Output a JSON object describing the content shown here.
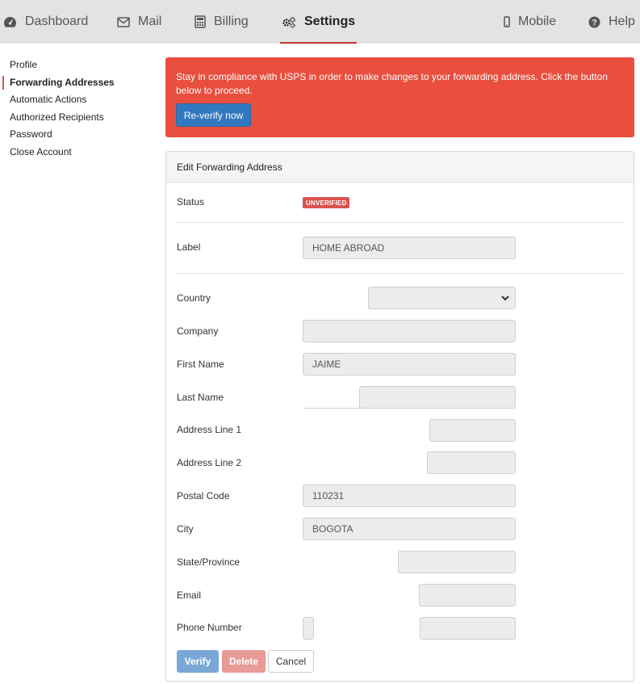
{
  "nav": {
    "items": [
      {
        "label": "Dashboard",
        "icon": "dashboard-gauge-icon"
      },
      {
        "label": "Mail",
        "icon": "envelope-icon"
      },
      {
        "label": "Billing",
        "icon": "calculator-icon"
      },
      {
        "label": "Settings",
        "icon": "gears-icon",
        "active": true
      },
      {
        "label": "Mobile",
        "icon": "mobile-phone-icon"
      },
      {
        "label": "Help",
        "icon": "question-circle-icon"
      }
    ]
  },
  "sidebar": {
    "items": [
      {
        "label": "Profile"
      },
      {
        "label": "Forwarding Addresses",
        "active": true
      },
      {
        "label": "Automatic Actions"
      },
      {
        "label": "Authorized Recipients"
      },
      {
        "label": "Password"
      },
      {
        "label": "Close Account"
      }
    ]
  },
  "alert": {
    "message": "Stay in compliance with USPS in order to make changes to your forwarding address. Click the button below to proceed.",
    "button_label": "Re-verify now",
    "color": "#e94e3e",
    "button_color": "#3278c0"
  },
  "form": {
    "title": "Edit Forwarding Address",
    "status": {
      "label": "Status",
      "badge": "UNVERIFIED",
      "badge_color": "#d9534f"
    },
    "label_field": {
      "label": "Label",
      "value": "HOME ABROAD"
    },
    "country": {
      "label": "Country",
      "value": ""
    },
    "company": {
      "label": "Company",
      "value": ""
    },
    "first_name": {
      "label": "First Name",
      "value": "JAIME"
    },
    "last_name": {
      "label": "Last Name",
      "value": ""
    },
    "address1": {
      "label": "Address Line 1",
      "value": ""
    },
    "address2": {
      "label": "Address Line 2",
      "value": ""
    },
    "postal_code": {
      "label": "Postal Code",
      "value": "110231"
    },
    "city": {
      "label": "City",
      "value": "BOGOTA"
    },
    "state": {
      "label": "State/Province",
      "value": ""
    },
    "email": {
      "label": "Email",
      "value": ""
    },
    "phone": {
      "label": "Phone Number",
      "value": ""
    },
    "buttons": {
      "verify": "Verify",
      "delete": "Delete",
      "cancel": "Cancel"
    }
  }
}
